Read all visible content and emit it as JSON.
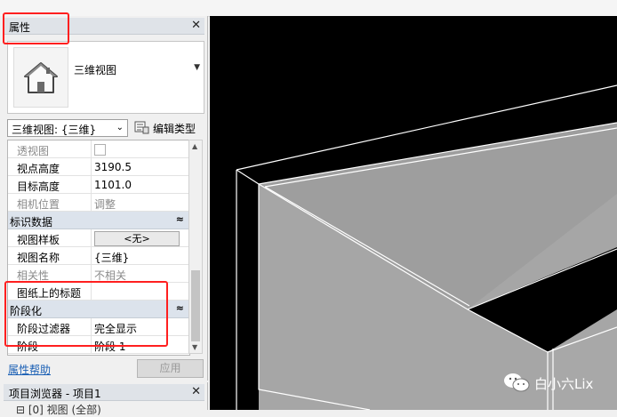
{
  "properties_panel": {
    "title": "属性",
    "close_glyph": "✕",
    "type_selector": {
      "name": "三维视图",
      "icon": "house-icon"
    },
    "view_selector": "三维视图: {三维}",
    "edit_type_label": "编辑类型",
    "rows_top": [
      {
        "name": "透视图",
        "value": "",
        "kind": "checkbox",
        "muted": true
      },
      {
        "name": "视点高度",
        "value": "3190.5",
        "kind": "text",
        "muted": false
      },
      {
        "name": "目标高度",
        "value": "1101.0",
        "kind": "text",
        "muted": false
      },
      {
        "name": "相机位置",
        "value": "调整",
        "kind": "text",
        "muted": true
      }
    ],
    "section_identity": "标识数据",
    "rows_identity": [
      {
        "name": "视图样板",
        "value": "<无>",
        "kind": "button",
        "muted": false
      },
      {
        "name": "视图名称",
        "value": "{三维}",
        "kind": "text",
        "muted": false
      },
      {
        "name": "相关性",
        "value": "不相关",
        "kind": "text",
        "muted": true
      },
      {
        "name": "图纸上的标题",
        "value": "",
        "kind": "text",
        "muted": false
      }
    ],
    "section_phasing": "阶段化",
    "rows_phasing": [
      {
        "name": "阶段过滤器",
        "value": "完全显示",
        "kind": "text",
        "muted": false
      },
      {
        "name": "阶段",
        "value": "阶段 1",
        "kind": "text",
        "muted": false
      }
    ],
    "collapse_glyph": "≈",
    "help_link": "属性帮助",
    "apply_button": "应用"
  },
  "project_browser": {
    "title": "项目浏览器 - 项目1",
    "close_glyph": "✕",
    "tree_first": "⊟ [0] 视图 (全部)"
  },
  "watermark": {
    "text": "白小六Lix",
    "icon": "wechat-icon"
  },
  "colors": {
    "highlight": "#ff1f1f",
    "viewport": "#000000",
    "model_face": "#a6a6a6",
    "link": "#1a5fb4"
  }
}
